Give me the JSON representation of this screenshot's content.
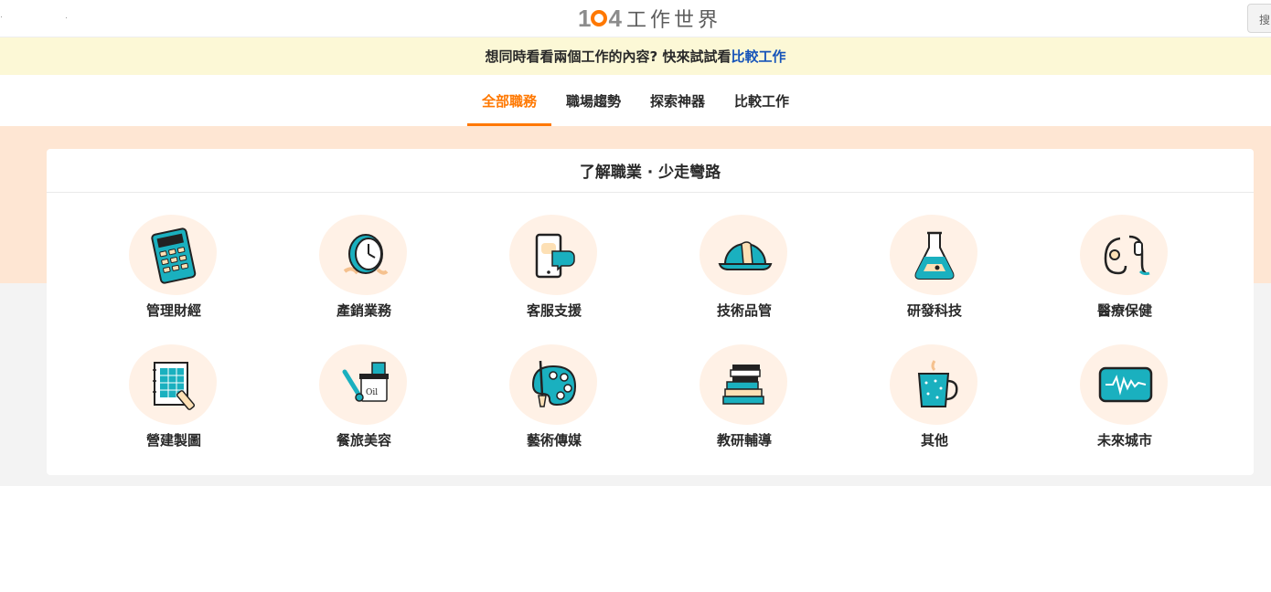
{
  "header": {
    "logo_number": "104",
    "logo_text": "工作世界",
    "search_button_label": "搜"
  },
  "notice": {
    "text": "想同時看看兩個工作的內容? 快來試試看",
    "link_text": "比較工作"
  },
  "tabs": [
    {
      "label": "全部職務",
      "active": true
    },
    {
      "label": "職場趨勢",
      "active": false
    },
    {
      "label": "探索神器",
      "active": false
    },
    {
      "label": "比較工作",
      "active": false
    }
  ],
  "card": {
    "title": "了解職業 · 少走彎路",
    "categories": [
      {
        "label": "管理財經",
        "icon": "calculator-icon"
      },
      {
        "label": "產銷業務",
        "icon": "clock-icon"
      },
      {
        "label": "客服支援",
        "icon": "phone-chat-icon"
      },
      {
        "label": "技術品管",
        "icon": "hard-hat-icon"
      },
      {
        "label": "研發科技",
        "icon": "flask-icon"
      },
      {
        "label": "醫療保健",
        "icon": "stethoscope-icon"
      },
      {
        "label": "營建製圖",
        "icon": "blueprint-icon"
      },
      {
        "label": "餐旅美容",
        "icon": "cosmetics-icon"
      },
      {
        "label": "藝術傳媒",
        "icon": "palette-icon"
      },
      {
        "label": "教研輔導",
        "icon": "books-icon"
      },
      {
        "label": "其他",
        "icon": "mug-icon"
      },
      {
        "label": "未來城市",
        "icon": "monitor-pulse-icon"
      }
    ]
  },
  "colors": {
    "accent": "#ff7800",
    "teal": "#1ab0bf",
    "link": "#1654b9",
    "notice_bg": "#fcf8d6",
    "peach_band": "#fee6d3"
  }
}
